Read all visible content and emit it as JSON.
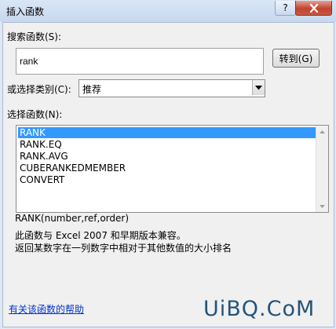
{
  "window": {
    "title": "插入函数",
    "help_glyph": "?"
  },
  "search": {
    "label": "搜索函数(S):",
    "value": "rank",
    "goto_label": "转到(G)"
  },
  "category": {
    "label": "或选择类别(C):",
    "selected": "推荐"
  },
  "functions": {
    "label": "选择函数(N):",
    "items": [
      "RANK",
      "RANK.EQ",
      "RANK.AVG",
      "CUBERANKEDMEMBER",
      "CONVERT"
    ],
    "selected_index": 0
  },
  "details": {
    "syntax": "RANK(number,ref,order)",
    "compat": "此函数与 Excel 2007 和早期版本兼容。",
    "description": "返回某数字在一列数字中相对于其他数值的大小排名"
  },
  "footer": {
    "help_link": "有关该函数的帮助"
  },
  "watermark": {
    "text": "UiBQ.CoM"
  }
}
